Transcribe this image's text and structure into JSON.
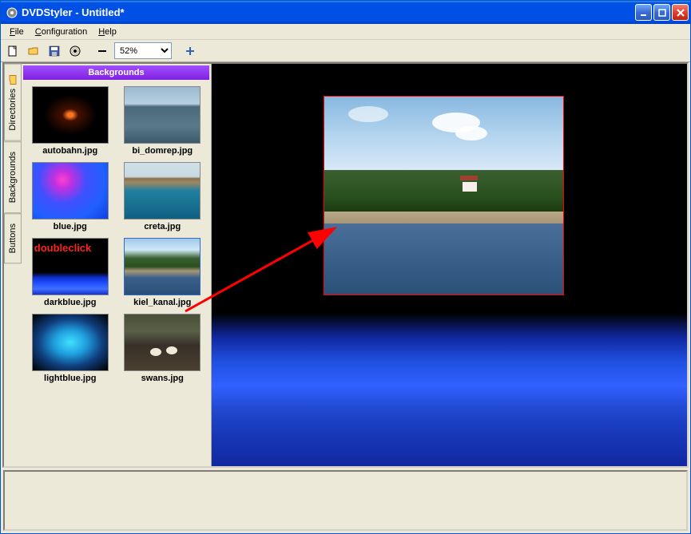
{
  "titlebar": {
    "text": "DVDStyler - Untitled*"
  },
  "menubar": {
    "file": "File",
    "configuration": "Configuration",
    "help": "Help"
  },
  "toolbar": {
    "zoom": "52%"
  },
  "sidetabs": {
    "directories": "Directories",
    "backgrounds": "Backgrounds",
    "buttons": "Buttons"
  },
  "panel": {
    "header": "Backgrounds",
    "thumbs": [
      {
        "caption": "autobahn.jpg",
        "cls": "bg-autobahn"
      },
      {
        "caption": "bi_domrep.jpg",
        "cls": "bg-domrep"
      },
      {
        "caption": "blue.jpg",
        "cls": "bg-blue"
      },
      {
        "caption": "creta.jpg",
        "cls": "bg-creta"
      },
      {
        "caption": "darkblue.jpg",
        "cls": "bg-darkblue",
        "overlay": "doubleclick"
      },
      {
        "caption": "kiel_kanal.jpg",
        "cls": "bg-kiel",
        "selected": true
      },
      {
        "caption": "lightblue.jpg",
        "cls": "bg-lightblue"
      },
      {
        "caption": "swans.jpg",
        "cls": "bg-swans",
        "swans": true
      }
    ]
  }
}
